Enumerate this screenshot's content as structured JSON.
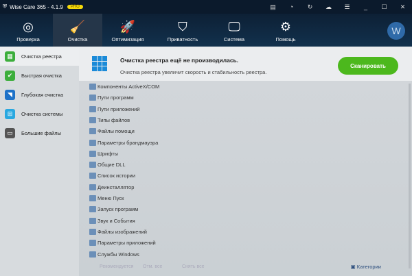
{
  "title": "Wise Care 365 - 4.1.9",
  "badge": "PRO",
  "window_controls": [
    "feedback-icon",
    "timer-icon",
    "refresh-icon",
    "cloud-icon",
    "menu-icon",
    "minimize-icon",
    "maximize-icon",
    "close-icon"
  ],
  "nav": [
    {
      "label": "Проверка",
      "icon": "radar-icon"
    },
    {
      "label": "Очистка",
      "icon": "broom-icon"
    },
    {
      "label": "Оптимизация",
      "icon": "rocket-icon"
    },
    {
      "label": "Приватность",
      "icon": "shield-icon"
    },
    {
      "label": "Система",
      "icon": "monitor-icon"
    },
    {
      "label": "Помощь",
      "icon": "tools-icon"
    }
  ],
  "avatar": "W",
  "sidebar": [
    {
      "label": "Очистка реестра",
      "color": "#3cae3c",
      "icon": "grid-icon"
    },
    {
      "label": "Быстрая очистка",
      "color": "#3cae3c",
      "icon": "check-icon"
    },
    {
      "label": "Глубокая очистка",
      "color": "#1e72c8",
      "icon": "deep-clean-icon"
    },
    {
      "label": "Очистка системы",
      "color": "#29a8e0",
      "icon": "windows-icon"
    },
    {
      "label": "Большие файлы",
      "color": "#555555",
      "icon": "folder-icon"
    }
  ],
  "header": {
    "title": "Очистка реестра ещё не производилась.",
    "subtitle": "Очистка реестра увеличит скорость и стабильность реестра.",
    "scan": "Сканировать"
  },
  "items": [
    "Компоненты ActiveX/COM",
    "Пути программ",
    "Пути приложений",
    "Типы файлов",
    "Файлы помощи",
    "Параметры брандмауэра",
    "Шрифты",
    "Общие DLL",
    "Список истории",
    "Деинсталлятор",
    "Меню Пуск",
    "Запуск программ",
    "Звук и События",
    "Файлы изображений",
    "Параметры приложений",
    "Службы Windows"
  ],
  "footer": {
    "recommended": "Рекомендуется",
    "select_all": "Отм. все",
    "deselect_all": "Снять все",
    "categories": "Категории"
  }
}
